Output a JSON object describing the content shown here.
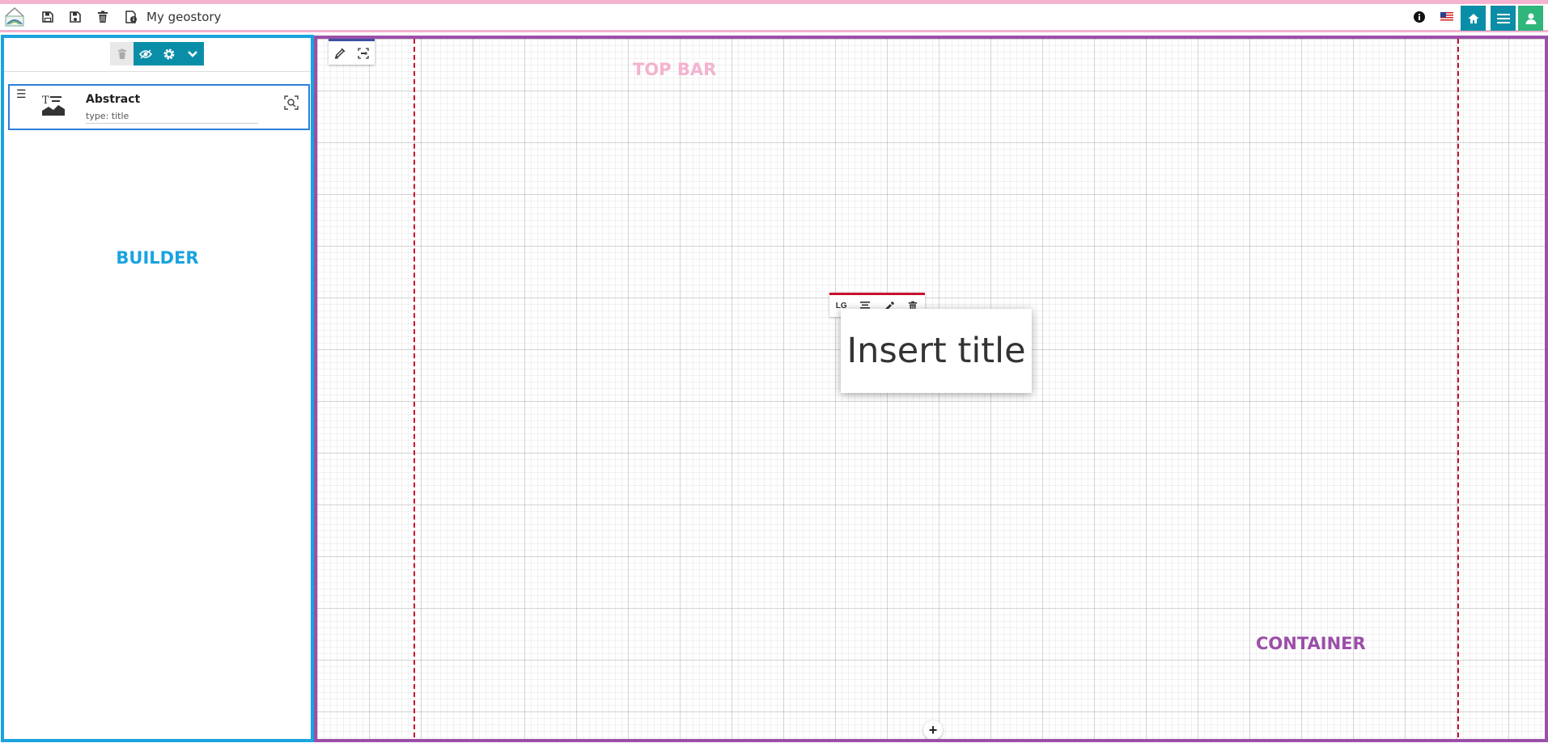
{
  "topbar": {
    "title": "My geostory",
    "icons": [
      "logo",
      "save-icon",
      "save-as-icon",
      "trash-icon",
      "details-icon",
      "info-icon",
      "flag-icon",
      "home-icon",
      "menu-icon",
      "user-icon"
    ]
  },
  "builder": {
    "label": "BUILDER",
    "toolbar_icons": [
      "trash-icon",
      "eye-icon",
      "gear-icon",
      "chevron-down-icon"
    ],
    "cards": [
      {
        "name": "Abstract",
        "subtitle": "type: title"
      }
    ]
  },
  "container": {
    "label": "CONTAINER",
    "top_bar_label": "TOP BAR",
    "title_toolbar": {
      "size_label": "LG"
    },
    "title_text": "Insert title",
    "add_label": "+"
  },
  "colors": {
    "topbar_border": "#f4b3cf",
    "builder_border": "#1aa3df",
    "container_border": "#9b4fa8",
    "accent_teal": "#0a8ea8",
    "accent_green": "#2fb67b",
    "guide_red": "#c8102e"
  }
}
